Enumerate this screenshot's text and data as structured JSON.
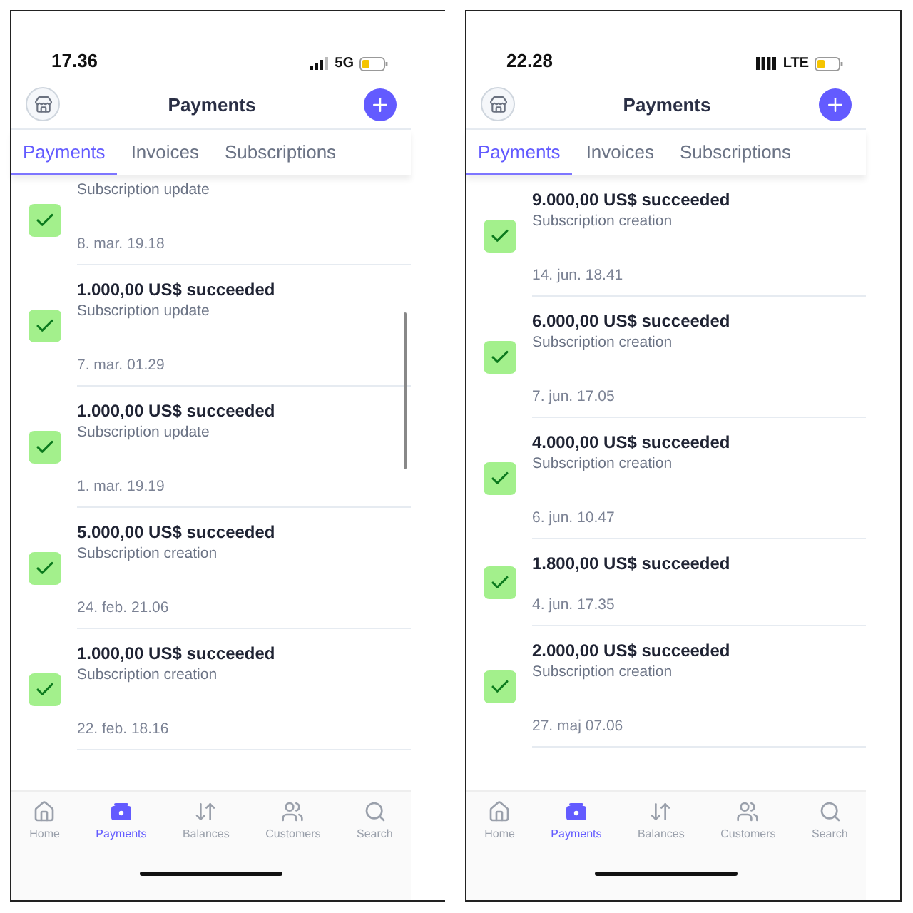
{
  "screens": [
    {
      "status_bar": {
        "time": "17.36",
        "network": "5G"
      },
      "header": {
        "title": "Payments"
      },
      "show_scrollbar": true,
      "tabs": [
        {
          "label": "Payments",
          "selected": true
        },
        {
          "label": "Invoices",
          "selected": false
        },
        {
          "label": "Subscriptions",
          "selected": false
        }
      ],
      "payments": [
        {
          "description": "Subscription update",
          "date": "8. mar. 19.18"
        },
        {
          "title": "1.000,00 US$ succeeded",
          "description": "Subscription update",
          "date": "7. mar. 01.29"
        },
        {
          "title": "1.000,00 US$ succeeded",
          "description": "Subscription update",
          "date": "1. mar. 19.19"
        },
        {
          "title": "5.000,00 US$ succeeded",
          "description": "Subscription creation",
          "date": "24. feb. 21.06"
        },
        {
          "title": "1.000,00 US$ succeeded",
          "description": "Subscription creation",
          "date": "22. feb. 18.16"
        }
      ],
      "nav": [
        {
          "label": "Home",
          "selected": false
        },
        {
          "label": "Payments",
          "selected": true
        },
        {
          "label": "Balances",
          "selected": false
        },
        {
          "label": "Customers",
          "selected": false
        },
        {
          "label": "Search",
          "selected": false
        }
      ]
    },
    {
      "status_bar": {
        "time": "22.28",
        "network": "LTE"
      },
      "header": {
        "title": "Payments"
      },
      "show_scrollbar": false,
      "tabs": [
        {
          "label": "Payments",
          "selected": true
        },
        {
          "label": "Invoices",
          "selected": false
        },
        {
          "label": "Subscriptions",
          "selected": false
        }
      ],
      "payments": [
        {
          "title": "9.000,00 US$ succeeded",
          "description": "Subscription creation",
          "date": "14. jun. 18.41"
        },
        {
          "title": "6.000,00 US$ succeeded",
          "description": "Subscription creation",
          "date": "7. jun. 17.05"
        },
        {
          "title": "4.000,00 US$ succeeded",
          "description": "Subscription creation",
          "date": "6. jun. 10.47"
        },
        {
          "title": "1.800,00 US$ succeeded",
          "date": "4. jun. 17.35"
        },
        {
          "title": "2.000,00 US$ succeeded",
          "description": "Subscription creation",
          "date": "27. maj 07.06"
        }
      ],
      "nav": [
        {
          "label": "Home",
          "selected": false
        },
        {
          "label": "Payments",
          "selected": true
        },
        {
          "label": "Balances",
          "selected": false
        },
        {
          "label": "Customers",
          "selected": false
        },
        {
          "label": "Search",
          "selected": false
        }
      ]
    }
  ]
}
